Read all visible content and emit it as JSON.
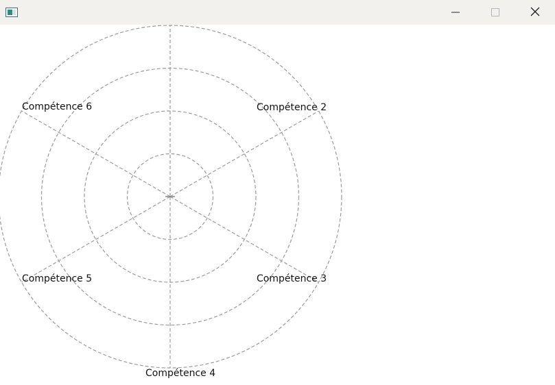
{
  "window": {
    "icons": {
      "app": "app-window-icon",
      "minimize": "minimize-icon",
      "maximize": "maximize-icon",
      "close": "close-icon"
    }
  },
  "radar": {
    "axes": [
      "",
      "Compétence 2",
      "Compétence 3",
      "Compétence 4",
      "Compétence 5",
      "Compétence 6"
    ],
    "rings": 4,
    "grid": true,
    "grid_style": "dashed",
    "grid_color": "#9a9a9a"
  },
  "colors": {
    "titlebar": "#f3f1ed",
    "background": "#ffffff",
    "grid": "#9a9a9a",
    "text": "#111111"
  }
}
